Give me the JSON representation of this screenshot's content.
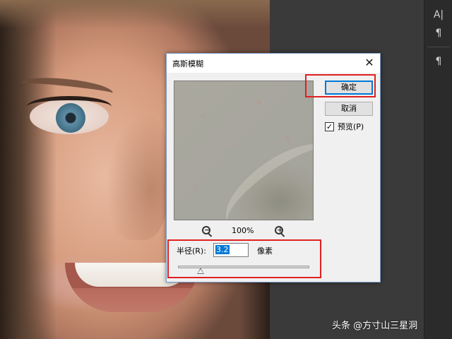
{
  "dialog": {
    "title": "高斯模糊",
    "close_glyph": "✕",
    "ok_label": "确定",
    "cancel_label": "取消",
    "preview_checkbox": {
      "checked": true,
      "check_glyph": "✓",
      "label": "预览(P)"
    },
    "zoom": {
      "level": "100%",
      "zoom_out_icon": "zoom-out-icon",
      "zoom_in_icon": "zoom-in-icon",
      "minus": "−",
      "plus": "+"
    },
    "radius": {
      "label": "半径(R):",
      "value": "3.2",
      "unit": "像素",
      "slider_fraction": 0.17
    }
  },
  "right_panel": {
    "tools": [
      {
        "glyph": "A|",
        "icon": "character-panel-icon"
      },
      {
        "glyph": "¶",
        "icon": "paragraph-panel-icon"
      },
      {
        "glyph": "¶",
        "icon": "paragraph-styles-icon"
      }
    ]
  },
  "annotation_color": "#e02020",
  "watermark": "头条 @方寸山三星洞"
}
